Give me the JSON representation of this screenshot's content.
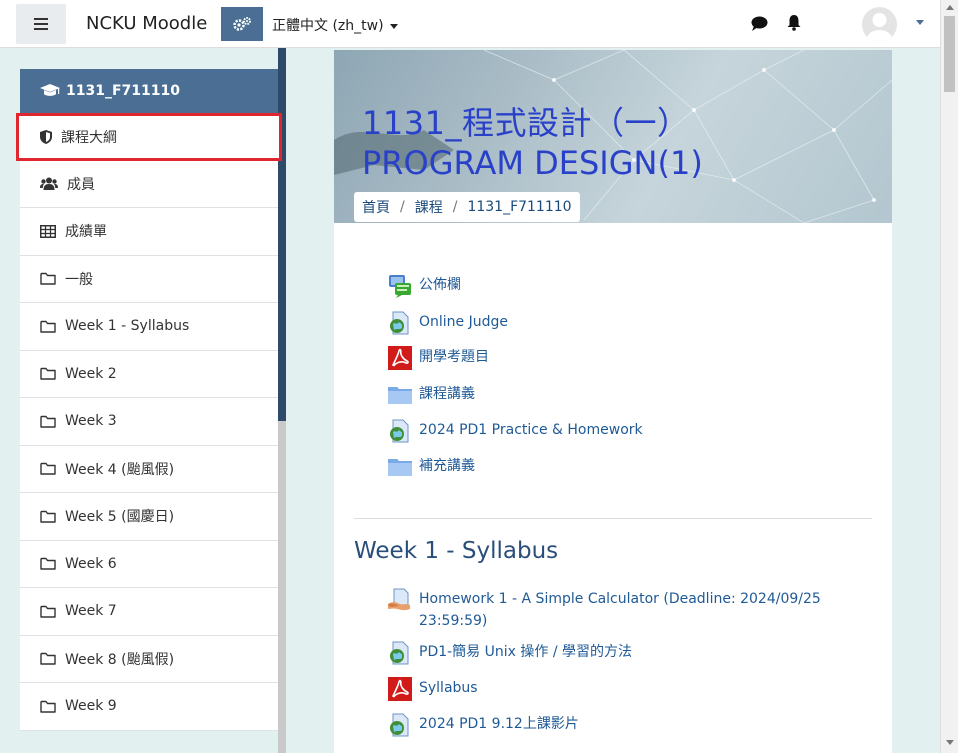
{
  "navbar": {
    "brand": "NCKU Moodle",
    "language": "正體中文 (zh_tw)"
  },
  "sidebar": {
    "course_code": "1131_F711110",
    "items": [
      {
        "label": "課程大綱",
        "icon": "shield-icon"
      },
      {
        "label": "成員",
        "icon": "users-icon"
      },
      {
        "label": "成績單",
        "icon": "table-icon"
      },
      {
        "label": "一般",
        "icon": "folder-icon"
      },
      {
        "label": "Week 1 - Syllabus",
        "icon": "folder-icon"
      },
      {
        "label": "Week 2",
        "icon": "folder-icon"
      },
      {
        "label": "Week 3",
        "icon": "folder-icon"
      },
      {
        "label": "Week 4 (颱風假)",
        "icon": "folder-icon"
      },
      {
        "label": "Week 5 (國慶日)",
        "icon": "folder-icon"
      },
      {
        "label": "Week 6",
        "icon": "folder-icon"
      },
      {
        "label": "Week 7",
        "icon": "folder-icon"
      },
      {
        "label": "Week 8 (颱風假)",
        "icon": "folder-icon"
      },
      {
        "label": "Week 9",
        "icon": "folder-icon"
      }
    ]
  },
  "banner": {
    "title_line1": "1131_程式設計（一）",
    "title_line2": "PROGRAM DESIGN(1)"
  },
  "breadcrumb": [
    "首頁",
    "課程",
    "1131_F711110"
  ],
  "general_activities": [
    {
      "label": "公佈欄",
      "icon": "forum-icon"
    },
    {
      "label": "Online Judge",
      "icon": "url-icon"
    },
    {
      "label": "開學考題目",
      "icon": "pdf-icon"
    },
    {
      "label": "課程講義",
      "icon": "folder-icon"
    },
    {
      "label": "2024 PD1 Practice & Homework",
      "icon": "url-icon"
    },
    {
      "label": "補充講義",
      "icon": "folder-icon"
    }
  ],
  "week1": {
    "title": "Week 1 - Syllabus",
    "activities": [
      {
        "label_line1": "Homework 1 - A Simple Calculator (Deadline: 2024/09/25",
        "label_line2": "23:59:59)",
        "icon": "assignment-icon"
      },
      {
        "label": "PD1-簡易 Unix 操作 / 學習的方法",
        "icon": "url-icon"
      },
      {
        "label": "Syllabus",
        "icon": "pdf-icon"
      },
      {
        "label": "2024 PD1 9.12上課影片",
        "icon": "url-icon"
      }
    ]
  }
}
